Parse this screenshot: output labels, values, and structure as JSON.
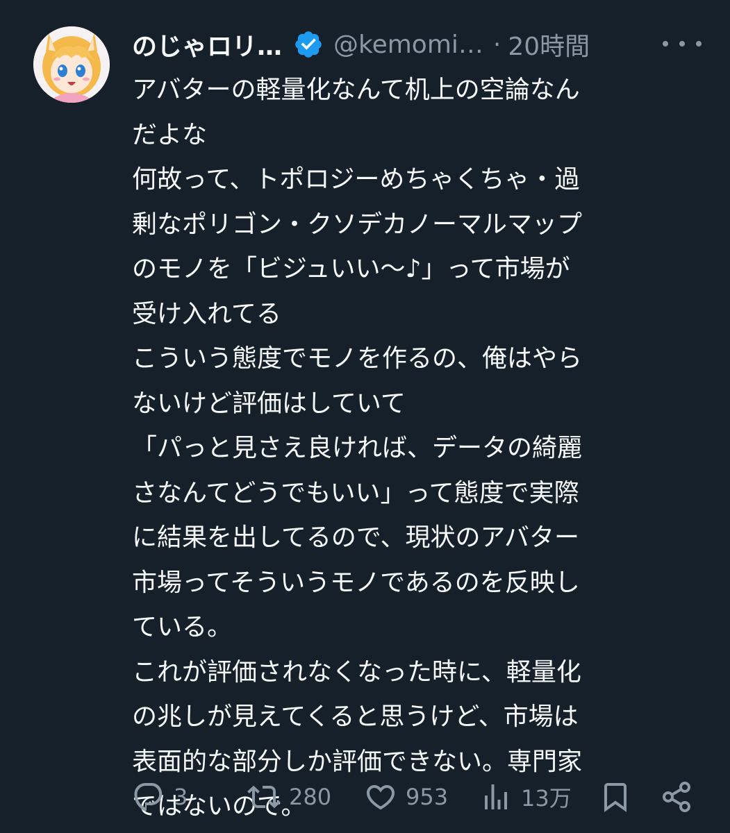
{
  "author": {
    "name": "のじゃロリ…",
    "handle": "@kemomi…",
    "separator": "·",
    "time": "20時間",
    "verified": true
  },
  "tweet": {
    "lines": [
      "アバターの軽量化なんて机上の空論なん",
      "だよな",
      "何故って、トポロジーめちゃくちゃ・過",
      "剰なポリゴン・クソデカノーマルマップ",
      "のモノを「ビジュいい〜♪」って市場が",
      "受け入れてる",
      "こういう態度でモノを作るの、俺はやら",
      "ないけど評価はしていて",
      "「パっと見さえ良ければ、データの綺麗",
      "さなんてどうでもいい」って態度で実際",
      "に結果を出してるので、現状のアバター",
      "市場ってそういうモノであるのを反映し",
      "ている。",
      "これが評価されなくなった時に、軽量化",
      "の兆しが見えてくると思うけど、市場は",
      "表面的な部分しか評価できない。専門家",
      "ではないので。"
    ]
  },
  "actions": {
    "replies": "3",
    "retweets": "280",
    "likes": "953",
    "views": "13万"
  },
  "colors": {
    "background": "#15202b",
    "text": "#f7f9f9",
    "muted": "#8b98a5",
    "verified": "#1d9bf0"
  },
  "icons": [
    "reply-icon",
    "retweet-icon",
    "like-icon",
    "views-icon",
    "bookmark-icon",
    "share-icon",
    "verified-icon",
    "more-icon"
  ]
}
